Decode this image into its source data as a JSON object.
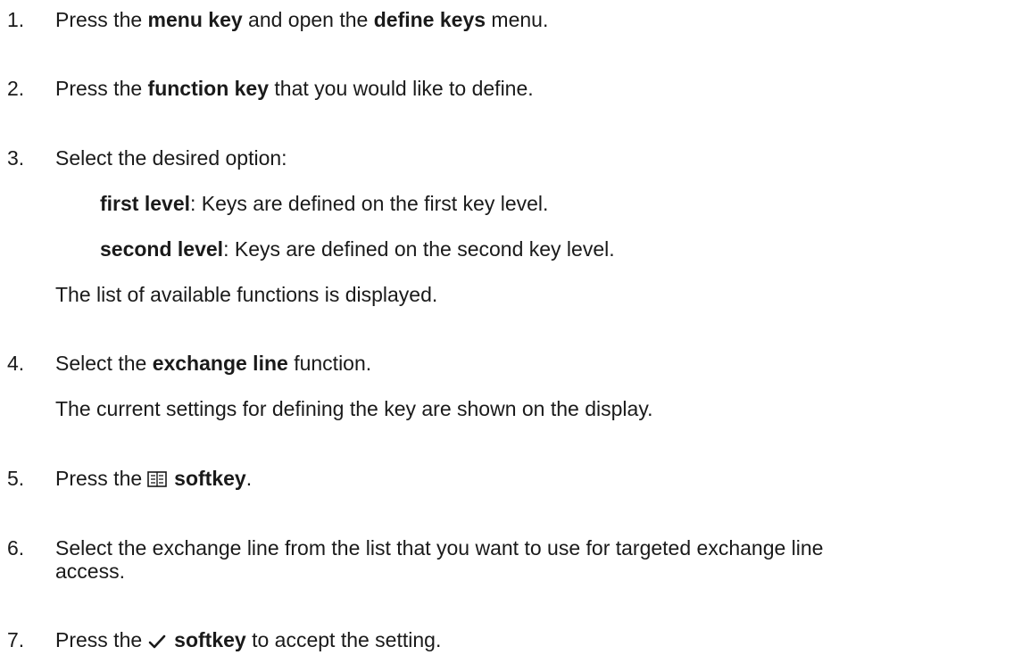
{
  "steps": [
    {
      "num": "1.",
      "a": "Press the ",
      "b1": "menu key",
      "c": " and open the ",
      "b2": "define keys",
      "d": " menu."
    },
    {
      "num": "2.",
      "a": "Press the ",
      "b1": "function key",
      "c": " that you would like to define."
    },
    {
      "num": "3.",
      "a": "Select the desired option:",
      "options": [
        {
          "bold": "first level",
          "rest": ": Keys are defined on the first key level."
        },
        {
          "bold": "second level",
          "rest": ": Keys are defined on the second key level."
        }
      ],
      "note": "The list of available functions is displayed."
    },
    {
      "num": "4.",
      "a": "Select the ",
      "b1": "exchange line",
      "c": " function.",
      "note": "The current settings for defining the key are shown on the display."
    },
    {
      "num": "5.",
      "a": "Press the",
      "icon": "phonebook-icon",
      "b1": "softkey",
      "c": "."
    },
    {
      "num": "6.",
      "line1": "Select the exchange line from the list that you want to use for targeted exchange line",
      "line2": "access."
    },
    {
      "num": "7.",
      "a": "Press the",
      "icon": "checkmark-icon",
      "b1": "softkey",
      "c": " to accept the setting."
    }
  ]
}
